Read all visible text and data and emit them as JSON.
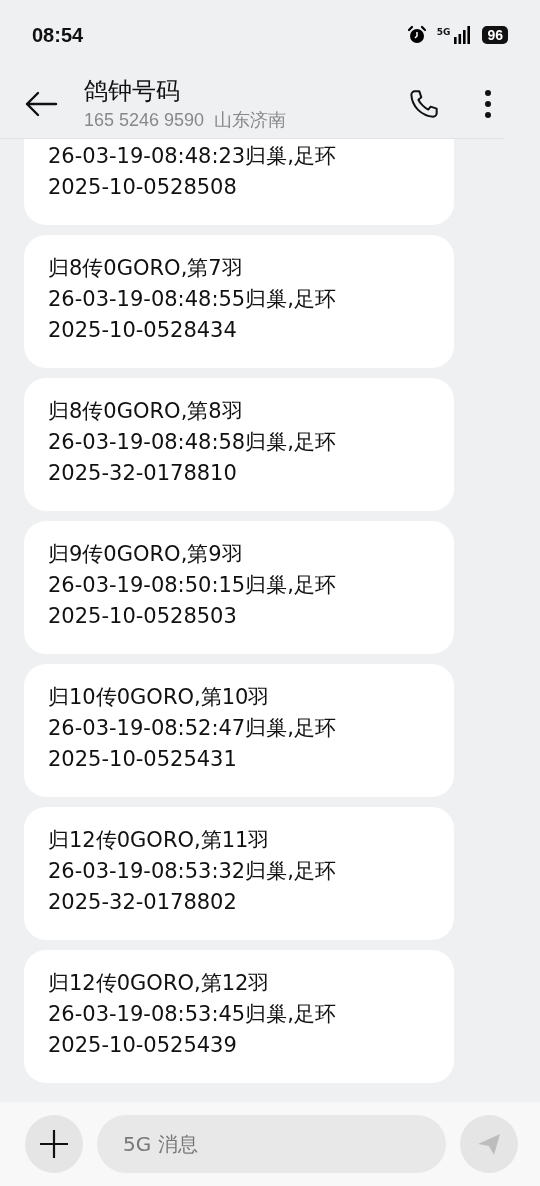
{
  "status_bar": {
    "time": "08:54",
    "network": "5G",
    "battery": "96"
  },
  "header": {
    "title": "鸽钟号码",
    "subtitle": "165 5246 9590  山东济南"
  },
  "messages": [
    {
      "lines": [
        "26-03-19-08:48:23归巢,足环",
        "2025-10-0528508"
      ]
    },
    {
      "lines": [
        "归8传0GORO,第7羽",
        "26-03-19-08:48:55归巢,足环",
        "2025-10-0528434"
      ]
    },
    {
      "lines": [
        "归8传0GORO,第8羽",
        "26-03-19-08:48:58归巢,足环",
        "2025-32-0178810"
      ]
    },
    {
      "lines": [
        "归9传0GORO,第9羽",
        "26-03-19-08:50:15归巢,足环",
        "2025-10-0528503"
      ]
    },
    {
      "lines": [
        "归10传0GORO,第10羽",
        "26-03-19-08:52:47归巢,足环",
        "2025-10-0525431"
      ]
    },
    {
      "lines": [
        "归12传0GORO,第11羽",
        "26-03-19-08:53:32归巢,足环",
        "2025-32-0178802"
      ]
    },
    {
      "lines": [
        "归12传0GORO,第12羽",
        "26-03-19-08:53:45归巢,足环",
        "2025-10-0525439"
      ]
    }
  ],
  "composer": {
    "placeholder": "5G 消息"
  }
}
